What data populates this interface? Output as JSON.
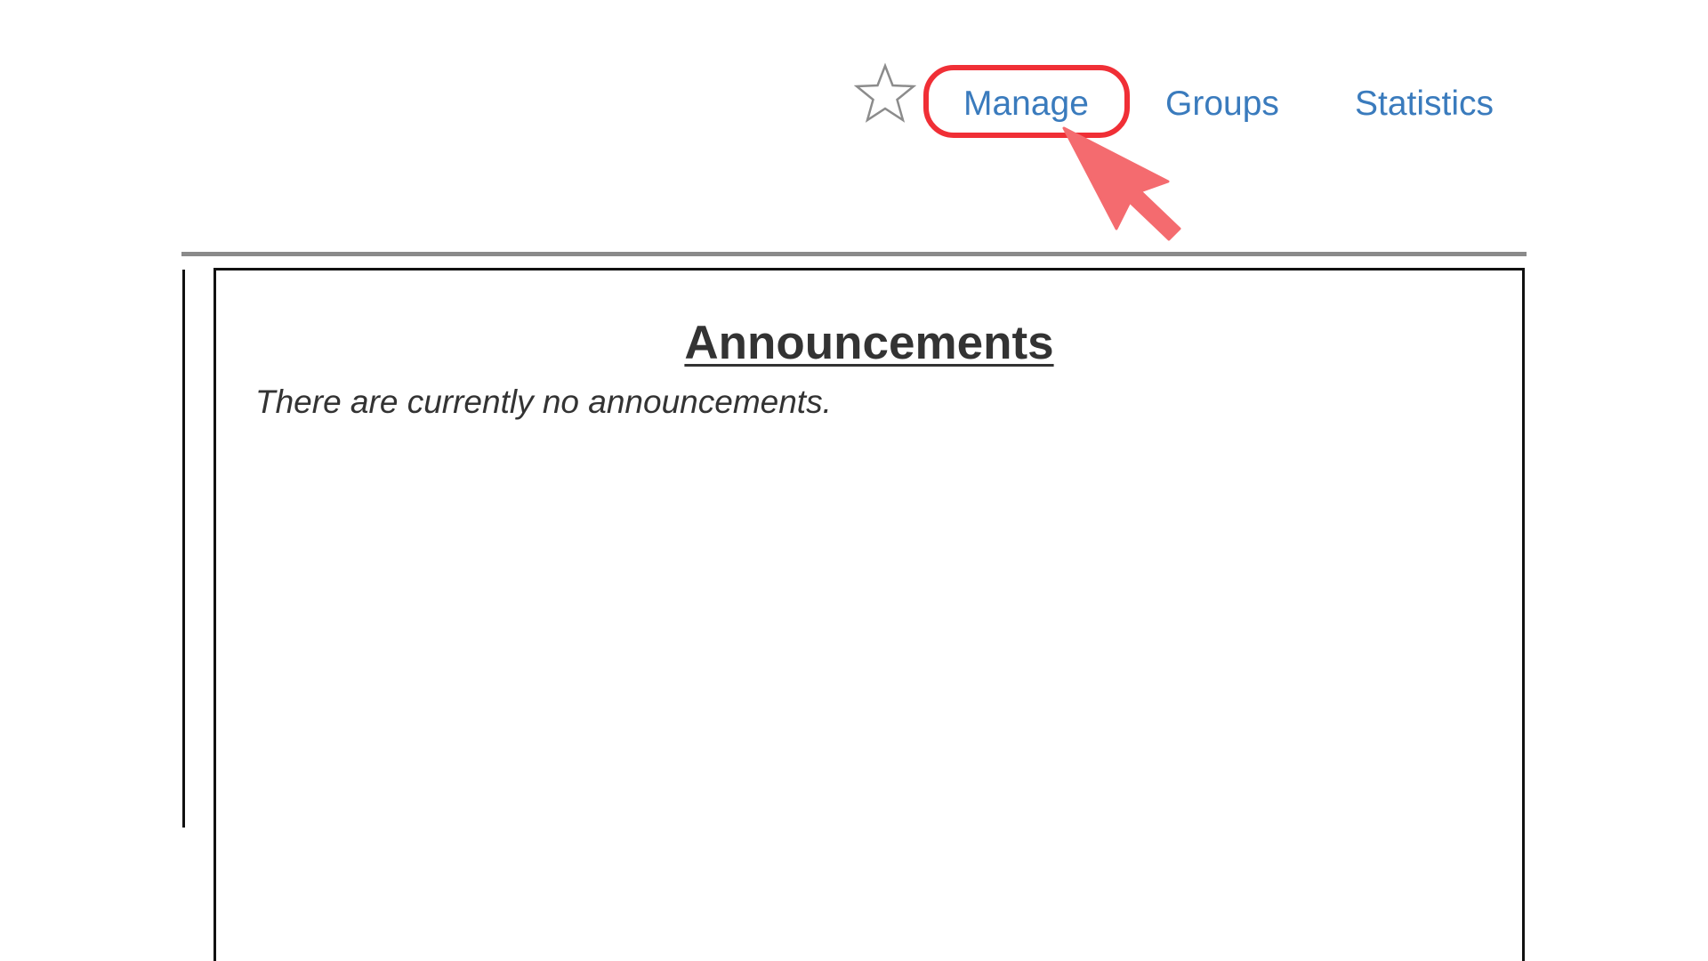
{
  "nav": {
    "favorite_icon": "star-outline-icon",
    "links": [
      {
        "label": "Manage"
      },
      {
        "label": "Groups"
      },
      {
        "label": "Statistics"
      }
    ]
  },
  "annotation": {
    "ring_color": "#f02f36",
    "arrow_color": "#f46b6f"
  },
  "announcements": {
    "title": "Announcements",
    "empty_message": "There are currently no announcements."
  },
  "colors": {
    "link": "#3a7bbd",
    "text": "#333333",
    "divider": "#8a8a8a"
  }
}
